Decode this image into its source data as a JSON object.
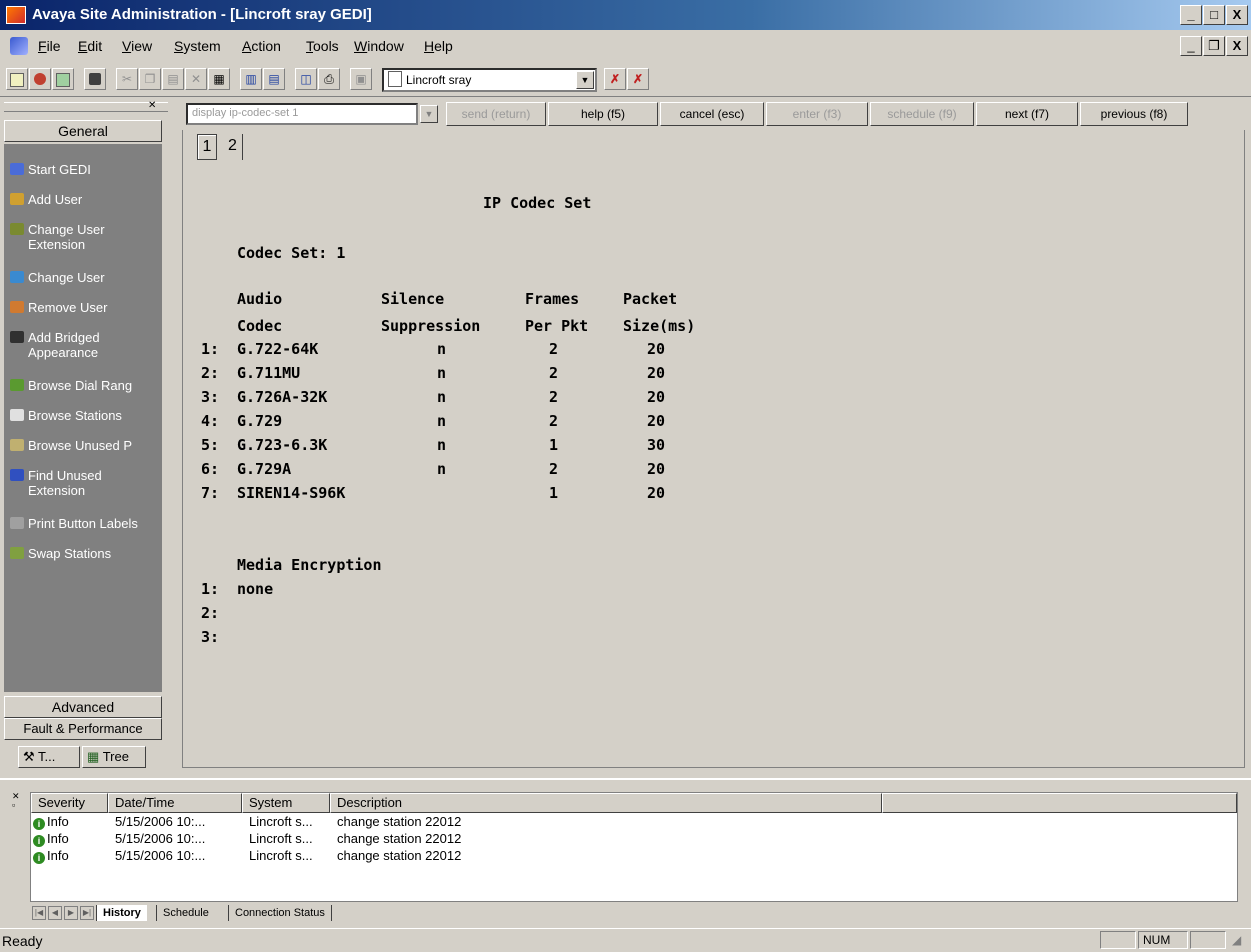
{
  "window": {
    "title": "Avaya Site Administration - [Lincroft sray GEDI]",
    "title_controls": [
      "_",
      "□",
      "X"
    ],
    "doc_controls": [
      "_",
      "❐",
      "X"
    ]
  },
  "menu": {
    "items": [
      {
        "pre": "",
        "acc": "F",
        "post": "ile"
      },
      {
        "pre": "",
        "acc": "E",
        "post": "dit"
      },
      {
        "pre": "",
        "acc": "V",
        "post": "iew"
      },
      {
        "pre": "",
        "acc": "S",
        "post": "ystem"
      },
      {
        "pre": "",
        "acc": "A",
        "post": "ction"
      },
      {
        "pre": "",
        "acc": "T",
        "post": "ools"
      },
      {
        "pre": "",
        "acc": "W",
        "post": "indow"
      },
      {
        "pre": "",
        "acc": "H",
        "post": "elp"
      }
    ]
  },
  "toolbar": {
    "system_select": "Lincroft sray"
  },
  "left_panel": {
    "general_label": "General",
    "advanced_label": "Advanced",
    "fault_label": "Fault & Performance",
    "tabs": [
      "T...",
      "Tree"
    ],
    "nav": [
      {
        "line1": "Start GEDI",
        "line2": "",
        "color": "#4a6cd8"
      },
      {
        "line1": "Add User",
        "line2": "",
        "color": "#d0a030"
      },
      {
        "line1": "Change User",
        "line2": "Extension",
        "color": "#7a8a30"
      },
      {
        "line1": "Change User",
        "line2": "",
        "color": "#3a8ad0"
      },
      {
        "line1": "Remove User",
        "line2": "",
        "color": "#d07a30"
      },
      {
        "line1": "Add Bridged",
        "line2": "Appearance",
        "color": "#303030"
      },
      {
        "line1": "Browse Dial Rang",
        "line2": "",
        "color": "#5a9a30"
      },
      {
        "line1": "Browse Stations",
        "line2": "",
        "color": "#e0e0e0"
      },
      {
        "line1": "Browse Unused P",
        "line2": "",
        "color": "#c0b070"
      },
      {
        "line1": "Find Unused",
        "line2": "Extension",
        "color": "#3050c0"
      },
      {
        "line1": "Print Button Labels",
        "line2": "",
        "color": "#a0a0a0"
      },
      {
        "line1": "Swap Stations",
        "line2": "",
        "color": "#80a040"
      }
    ]
  },
  "command_bar": {
    "command_value": "display ip-codec-set 1",
    "buttons": [
      "send (return)",
      "help (f5)",
      "cancel (esc)",
      "enter (f3)",
      "schedule (f9)",
      "next (f7)",
      "previous (f8)"
    ]
  },
  "form": {
    "page_tabs": [
      "1",
      "2"
    ],
    "title": "IP Codec Set",
    "codec_set_label": "Codec Set: 1",
    "headers": {
      "h1a": "Audio",
      "h1b": "Silence",
      "h1c": "Frames",
      "h1d": "Packet",
      "h2a": "Codec",
      "h2b": "Suppression",
      "h2c": "Per Pkt",
      "h2d": "Size(ms)"
    },
    "rows": [
      {
        "num": "1:",
        "codec": "G.722-64K",
        "silence": "n",
        "frames": "2",
        "size": "20"
      },
      {
        "num": "2:",
        "codec": "G.711MU",
        "silence": "n",
        "frames": "2",
        "size": "20"
      },
      {
        "num": "3:",
        "codec": "G.726A-32K",
        "silence": "n",
        "frames": "2",
        "size": "20"
      },
      {
        "num": "4:",
        "codec": "G.729",
        "silence": "n",
        "frames": "2",
        "size": "20"
      },
      {
        "num": "5:",
        "codec": "G.723-6.3K",
        "silence": "n",
        "frames": "1",
        "size": "30"
      },
      {
        "num": "6:",
        "codec": "G.729A",
        "silence": "n",
        "frames": "2",
        "size": "20"
      },
      {
        "num": "7:",
        "codec": "SIREN14-S96K",
        "silence": "",
        "frames": "1",
        "size": "20"
      }
    ],
    "media_label": "Media Encryption",
    "media_rows": [
      {
        "num": "1:",
        "value": "none"
      },
      {
        "num": "2:",
        "value": ""
      },
      {
        "num": "3:",
        "value": ""
      }
    ]
  },
  "log": {
    "columns": [
      "Severity",
      "Date/Time",
      "System",
      "Description"
    ],
    "rows": [
      {
        "severity": "Info",
        "datetime": "5/15/2006 10:...",
        "system": "Lincroft s...",
        "description": "change station 22012"
      },
      {
        "severity": "Info",
        "datetime": "5/15/2006 10:...",
        "system": "Lincroft s...",
        "description": "change station 22012"
      },
      {
        "severity": "Info",
        "datetime": "5/15/2006 10:...",
        "system": "Lincroft s...",
        "description": "change station 22012"
      }
    ],
    "tabs": [
      "History",
      "Schedule",
      "Connection Status"
    ]
  },
  "status": {
    "text": "Ready",
    "num": "NUM"
  }
}
